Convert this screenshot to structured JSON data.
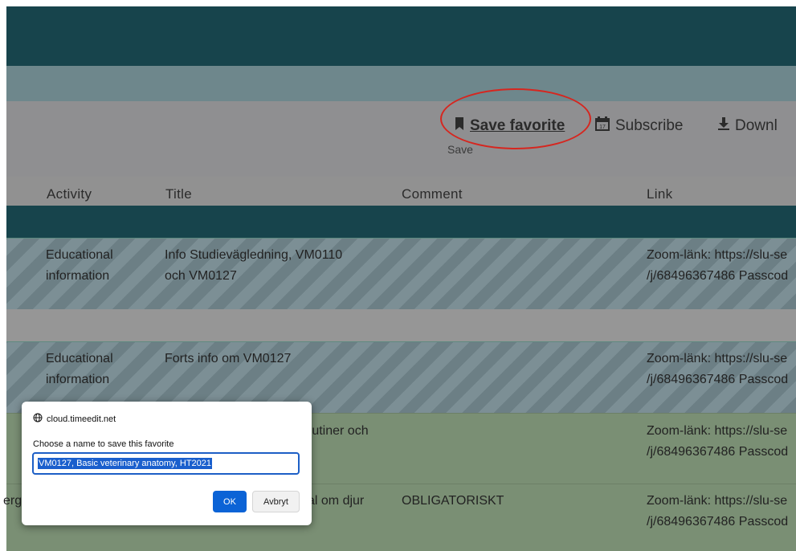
{
  "toolbar": {
    "save_favorite": "Save favorite",
    "subscribe": "Subscribe",
    "download": "Downl",
    "save_tooltip": "Save"
  },
  "table": {
    "headers": [
      "Activity",
      "Title",
      "Comment",
      "Link"
    ],
    "rows": [
      {
        "activity": [
          "Educational",
          "information"
        ],
        "title": [
          "Info Studievägledning, VM0110",
          "och VM0127"
        ],
        "comment": "",
        "link": [
          "Zoom-länk: https://slu-se",
          "/j/68496367486 Passcod"
        ]
      },
      {
        "activity": [
          "Educational",
          "information"
        ],
        "title": [
          "Forts info om VM0127"
        ],
        "comment": "",
        "link": [
          "Zoom-länk: https://slu-se",
          "/j/68496367486 Passcod"
        ]
      },
      {
        "activity": [],
        "title": [
          "rutiner och"
        ],
        "comment": "",
        "link": [
          "Zoom-länk: https://slu-se",
          "/j/68496367486 Passcod"
        ]
      },
      {
        "activity": [
          "erg"
        ],
        "title": [
          "al om djur"
        ],
        "comment": "OBLIGATORISKT",
        "link": [
          "Zoom-länk: https://slu-se",
          "/j/68496367486 Passcod"
        ]
      }
    ]
  },
  "dialog": {
    "origin": "cloud.timeedit.net",
    "message": "Choose a name to save this favorite",
    "input_value": "VM0127, Basic veterinary anatomy, HT2021",
    "ok_label": "OK",
    "cancel_label": "Avbryt"
  },
  "colors": {
    "header": "#17444c",
    "annotation": "#d6261f",
    "ok_button": "#0b63d6"
  },
  "icons": [
    "bookmark-icon",
    "calendar-icon",
    "download-icon",
    "globe-icon"
  ]
}
